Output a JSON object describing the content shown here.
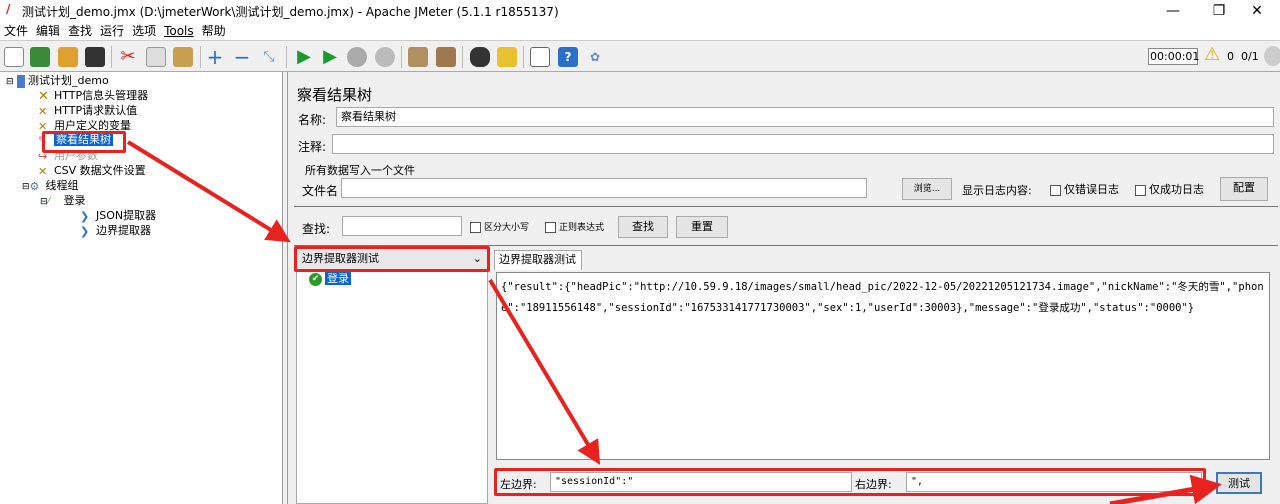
{
  "window": {
    "title": "测试计划_demo.jmx (D:\\jmeterWork\\测试计划_demo.jmx) - Apache JMeter (5.1.1 r1855137)",
    "minimize": "—",
    "maximize": "❐",
    "close": "✕"
  },
  "menu": [
    "文件",
    "编辑",
    "查找",
    "运行",
    "选项",
    "Tools",
    "帮助"
  ],
  "toolbar": {
    "timer": "00:00:01",
    "warnings": "0",
    "threads": "0/1",
    "icons": [
      "new-icon",
      "templates-icon",
      "open-icon",
      "save-icon",
      "cut-icon",
      "copy-icon",
      "paste-icon",
      "expand-icon",
      "collapse-icon",
      "toggle-icon",
      "start-icon",
      "start-no-pause-icon",
      "stop-icon",
      "shutdown-icon",
      "clear-icon",
      "clear-all-icon",
      "search-icon",
      "reset-search-icon",
      "function-helper-icon",
      "help-icon",
      "log-viewer-icon"
    ]
  },
  "tree": {
    "items": [
      {
        "label": "测试计划_demo",
        "level": 0
      },
      {
        "label": "HTTP信息头管理器",
        "level": 1
      },
      {
        "label": "HTTP请求默认值",
        "level": 1
      },
      {
        "label": "用户定义的变量",
        "level": 1
      },
      {
        "label": "察看结果树",
        "level": 1,
        "selected": true
      },
      {
        "label": "用户参数",
        "level": 1,
        "disabled": true
      },
      {
        "label": "CSV 数据文件设置",
        "level": 1
      },
      {
        "label": "线程组",
        "level": 1
      },
      {
        "label": "登录",
        "level": 2
      },
      {
        "label": "JSON提取器",
        "level": 3
      },
      {
        "label": "边界提取器",
        "level": 3
      }
    ]
  },
  "panel": {
    "title": "察看结果树",
    "name_label": "名称:",
    "name_value": "察看结果树",
    "comment_label": "注释:",
    "comment_value": "",
    "file_group": "所有数据写入一个文件",
    "file_label": "文件名",
    "file_value": "",
    "browse": "浏览...",
    "log_label": "显示日志内容:",
    "errors_only": "仅错误日志",
    "success_only": "仅成功日志",
    "configure": "配置",
    "search_label": "查找:",
    "search_value": "",
    "case_sensitive": "区分大小写",
    "regex": "正则表达式",
    "search_btn": "查找",
    "reset_btn": "重置",
    "renderer": "边界提取器测试",
    "result_item": "登录",
    "tab": "边界提取器测试",
    "response": "{\"result\":{\"headPic\":\"http://10.59.9.18/images/small/head_pic/2022-12-05/20221205121734.image\",\"nickName\":\"冬天的雪\",\"phone\":\"18911556148\",\"sessionId\":\"167533141771730003\",\"sex\":1,\"userId\":30003},\"message\":\"登录成功\",\"status\":\"0000\"}",
    "left_label": "左边界:",
    "left_value": "\"sessionId\":\"",
    "right_label": "右边界:",
    "right_value": "\",",
    "test_btn": "测试"
  },
  "colors": {
    "annotation": "#e8231f",
    "selection": "#0a64d0"
  }
}
